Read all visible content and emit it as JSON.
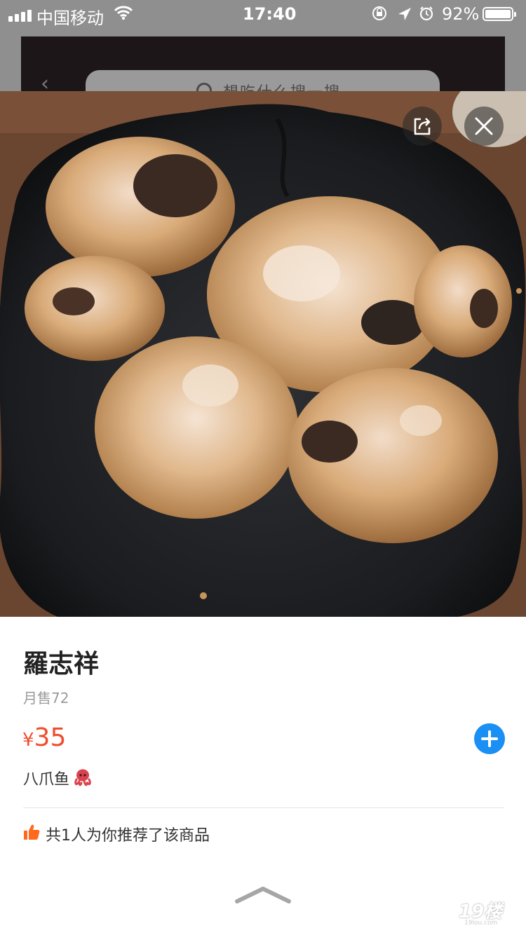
{
  "status_bar": {
    "carrier": "中国移动",
    "time": "17:40",
    "battery": "92%",
    "battery_level": 0.92
  },
  "background": {
    "search_placeholder": "想吃什么搜一搜"
  },
  "dish": {
    "name": "羅志祥",
    "monthly_sales": "月售72",
    "price_symbol": "¥",
    "price": "35",
    "description": "八爪鱼",
    "description_emoji": "octopus-icon"
  },
  "recommend": {
    "text": "共1人为你推荐了该商品"
  },
  "watermark": {
    "logo": "19楼",
    "sub": "19lou.com"
  },
  "colors": {
    "price": "#f04c2c",
    "add_button": "#1a8ff4",
    "thumb": "#ff6a1f"
  }
}
